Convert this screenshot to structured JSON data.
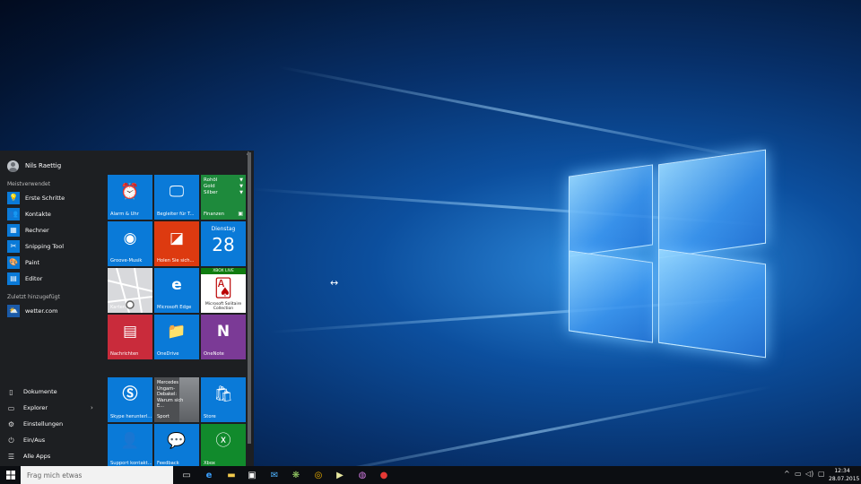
{
  "user": {
    "name": "Nils Raettig"
  },
  "most_used": {
    "heading": "Meistverwendet",
    "items": [
      {
        "label": "Erste Schritte",
        "icon": "lightbulb-icon",
        "color": "#0a7ad8"
      },
      {
        "label": "Kontakte",
        "icon": "contacts-icon",
        "color": "#0a7ad8"
      },
      {
        "label": "Rechner",
        "icon": "calculator-icon",
        "color": "#0a7ad8"
      },
      {
        "label": "Snipping Tool",
        "icon": "scissors-icon",
        "color": "#0a7ad8"
      },
      {
        "label": "Paint",
        "icon": "paint-icon",
        "color": "#0a7ad8"
      },
      {
        "label": "Editor",
        "icon": "notepad-icon",
        "color": "#0a7ad8"
      }
    ]
  },
  "recent": {
    "heading": "Zuletzt hinzugefügt",
    "items": [
      {
        "label": "wetter.com",
        "icon": "weather-icon",
        "color": "#1a5aa8"
      }
    ]
  },
  "bottom": {
    "documents": "Dokumente",
    "explorer": "Explorer",
    "settings": "Einstellungen",
    "power": "Ein/Aus",
    "all_apps": "Alle Apps"
  },
  "tiles": {
    "alarm": {
      "label": "Alarm & Uhr",
      "color": "#0a7ad8"
    },
    "companion": {
      "label": "Begleiter für T...",
      "color": "#0a7ad8"
    },
    "finance": {
      "label": "Finanzen",
      "color": "#1e8a3c",
      "rows": [
        "Rohöl",
        "Gold",
        "Silber"
      ]
    },
    "groove": {
      "label": "Groove-Musik",
      "color": "#0a7ad8"
    },
    "office": {
      "label": "Holen Sie sich...",
      "color": "#dd3a10"
    },
    "calendar": {
      "label": "Dienstag",
      "day": "28",
      "color": "#0a7ad8"
    },
    "maps": {
      "label": "Karten",
      "color": "#d8d9dc"
    },
    "edge": {
      "label": "Microsoft Edge",
      "color": "#0a7ad8"
    },
    "solitaire": {
      "badge": "XBOX LIVE",
      "label": "Microsoft Solitaire Collection",
      "color": "#ffffff"
    },
    "news": {
      "label": "Nachrichten",
      "color": "#c92b3b"
    },
    "onedrive": {
      "label": "OneDrive",
      "color": "#0a7ad8"
    },
    "onenote": {
      "label": "OneNote",
      "color": "#7b3a96"
    },
    "skype": {
      "label": "Skype herunterl...",
      "color": "#0a7ad8"
    },
    "sport": {
      "label": "Sport",
      "headline": "Mercedes Ungarn-Debakel: Warum sich E...",
      "color": "#4d4f52"
    },
    "store": {
      "label": "Store",
      "color": "#0a7ad8"
    },
    "support": {
      "label": "Support kontakt...",
      "color": "#0a7ad8"
    },
    "feedback": {
      "label": "Feedback",
      "color": "#0a7ad8"
    },
    "xbox": {
      "label": "Xbox",
      "color": "#118a2c"
    }
  },
  "taskbar": {
    "search_placeholder": "Frag mich etwas",
    "time": "12:34",
    "date": "28.07.2015"
  }
}
